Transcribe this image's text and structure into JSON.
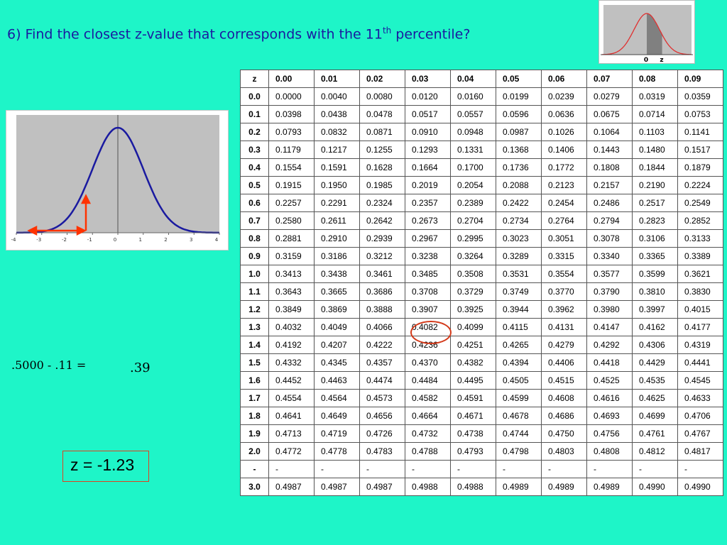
{
  "question": {
    "prefix": "6) Find the closest z-value that corresponds with the 11",
    "superscript": "th",
    "suffix": " percentile?"
  },
  "thumbnail": {
    "labels": [
      "0",
      "z"
    ],
    "colors": {
      "curve": "#e03030",
      "shade": "#808080",
      "background": "#c0c0c0"
    }
  },
  "plot": {
    "x_ticks": [
      "-4",
      "-3",
      "-2",
      "-1",
      "0",
      "1",
      "2",
      "3",
      "4"
    ],
    "colors": {
      "curve": "#1a1aa0",
      "arrows": "#ff3300",
      "background": "#c0c0c0"
    }
  },
  "calc": {
    "expression": ".5000 - .11 =",
    "result": ".39"
  },
  "answer": "z = -1.23",
  "highlight": {
    "row": 12,
    "col": 3,
    "color": "#d33a1a"
  },
  "table": {
    "header": [
      "z",
      "0.00",
      "0.01",
      "0.02",
      "0.03",
      "0.04",
      "0.05",
      "0.06",
      "0.07",
      "0.08",
      "0.09"
    ],
    "rows": [
      [
        "0.0",
        "0.0000",
        "0.0040",
        "0.0080",
        "0.0120",
        "0.0160",
        "0.0199",
        "0.0239",
        "0.0279",
        "0.0319",
        "0.0359"
      ],
      [
        "0.1",
        "0.0398",
        "0.0438",
        "0.0478",
        "0.0517",
        "0.0557",
        "0.0596",
        "0.0636",
        "0.0675",
        "0.0714",
        "0.0753"
      ],
      [
        "0.2",
        "0.0793",
        "0.0832",
        "0.0871",
        "0.0910",
        "0.0948",
        "0.0987",
        "0.1026",
        "0.1064",
        "0.1103",
        "0.1141"
      ],
      [
        "0.3",
        "0.1179",
        "0.1217",
        "0.1255",
        "0.1293",
        "0.1331",
        "0.1368",
        "0.1406",
        "0.1443",
        "0.1480",
        "0.1517"
      ],
      [
        "0.4",
        "0.1554",
        "0.1591",
        "0.1628",
        "0.1664",
        "0.1700",
        "0.1736",
        "0.1772",
        "0.1808",
        "0.1844",
        "0.1879"
      ],
      [
        "0.5",
        "0.1915",
        "0.1950",
        "0.1985",
        "0.2019",
        "0.2054",
        "0.2088",
        "0.2123",
        "0.2157",
        "0.2190",
        "0.2224"
      ],
      [
        "0.6",
        "0.2257",
        "0.2291",
        "0.2324",
        "0.2357",
        "0.2389",
        "0.2422",
        "0.2454",
        "0.2486",
        "0.2517",
        "0.2549"
      ],
      [
        "0.7",
        "0.2580",
        "0.2611",
        "0.2642",
        "0.2673",
        "0.2704",
        "0.2734",
        "0.2764",
        "0.2794",
        "0.2823",
        "0.2852"
      ],
      [
        "0.8",
        "0.2881",
        "0.2910",
        "0.2939",
        "0.2967",
        "0.2995",
        "0.3023",
        "0.3051",
        "0.3078",
        "0.3106",
        "0.3133"
      ],
      [
        "0.9",
        "0.3159",
        "0.3186",
        "0.3212",
        "0.3238",
        "0.3264",
        "0.3289",
        "0.3315",
        "0.3340",
        "0.3365",
        "0.3389"
      ],
      [
        "1.0",
        "0.3413",
        "0.3438",
        "0.3461",
        "0.3485",
        "0.3508",
        "0.3531",
        "0.3554",
        "0.3577",
        "0.3599",
        "0.3621"
      ],
      [
        "1.1",
        "0.3643",
        "0.3665",
        "0.3686",
        "0.3708",
        "0.3729",
        "0.3749",
        "0.3770",
        "0.3790",
        "0.3810",
        "0.3830"
      ],
      [
        "1.2",
        "0.3849",
        "0.3869",
        "0.3888",
        "0.3907",
        "0.3925",
        "0.3944",
        "0.3962",
        "0.3980",
        "0.3997",
        "0.4015"
      ],
      [
        "1.3",
        "0.4032",
        "0.4049",
        "0.4066",
        "0.4082",
        "0.4099",
        "0.4115",
        "0.4131",
        "0.4147",
        "0.4162",
        "0.4177"
      ],
      [
        "1.4",
        "0.4192",
        "0.4207",
        "0.4222",
        "0.4236",
        "0.4251",
        "0.4265",
        "0.4279",
        "0.4292",
        "0.4306",
        "0.4319"
      ],
      [
        "1.5",
        "0.4332",
        "0.4345",
        "0.4357",
        "0.4370",
        "0.4382",
        "0.4394",
        "0.4406",
        "0.4418",
        "0.4429",
        "0.4441"
      ],
      [
        "1.6",
        "0.4452",
        "0.4463",
        "0.4474",
        "0.4484",
        "0.4495",
        "0.4505",
        "0.4515",
        "0.4525",
        "0.4535",
        "0.4545"
      ],
      [
        "1.7",
        "0.4554",
        "0.4564",
        "0.4573",
        "0.4582",
        "0.4591",
        "0.4599",
        "0.4608",
        "0.4616",
        "0.4625",
        "0.4633"
      ],
      [
        "1.8",
        "0.4641",
        "0.4649",
        "0.4656",
        "0.4664",
        "0.4671",
        "0.4678",
        "0.4686",
        "0.4693",
        "0.4699",
        "0.4706"
      ],
      [
        "1.9",
        "0.4713",
        "0.4719",
        "0.4726",
        "0.4732",
        "0.4738",
        "0.4744",
        "0.4750",
        "0.4756",
        "0.4761",
        "0.4767"
      ],
      [
        "2.0",
        "0.4772",
        "0.4778",
        "0.4783",
        "0.4788",
        "0.4793",
        "0.4798",
        "0.4803",
        "0.4808",
        "0.4812",
        "0.4817"
      ],
      [
        "-",
        "-",
        "-",
        "-",
        "-",
        "-",
        "-",
        "-",
        "-",
        "-",
        "-"
      ],
      [
        "3.0",
        "0.4987",
        "0.4987",
        "0.4987",
        "0.4988",
        "0.4988",
        "0.4989",
        "0.4989",
        "0.4989",
        "0.4990",
        "0.4990"
      ]
    ]
  }
}
